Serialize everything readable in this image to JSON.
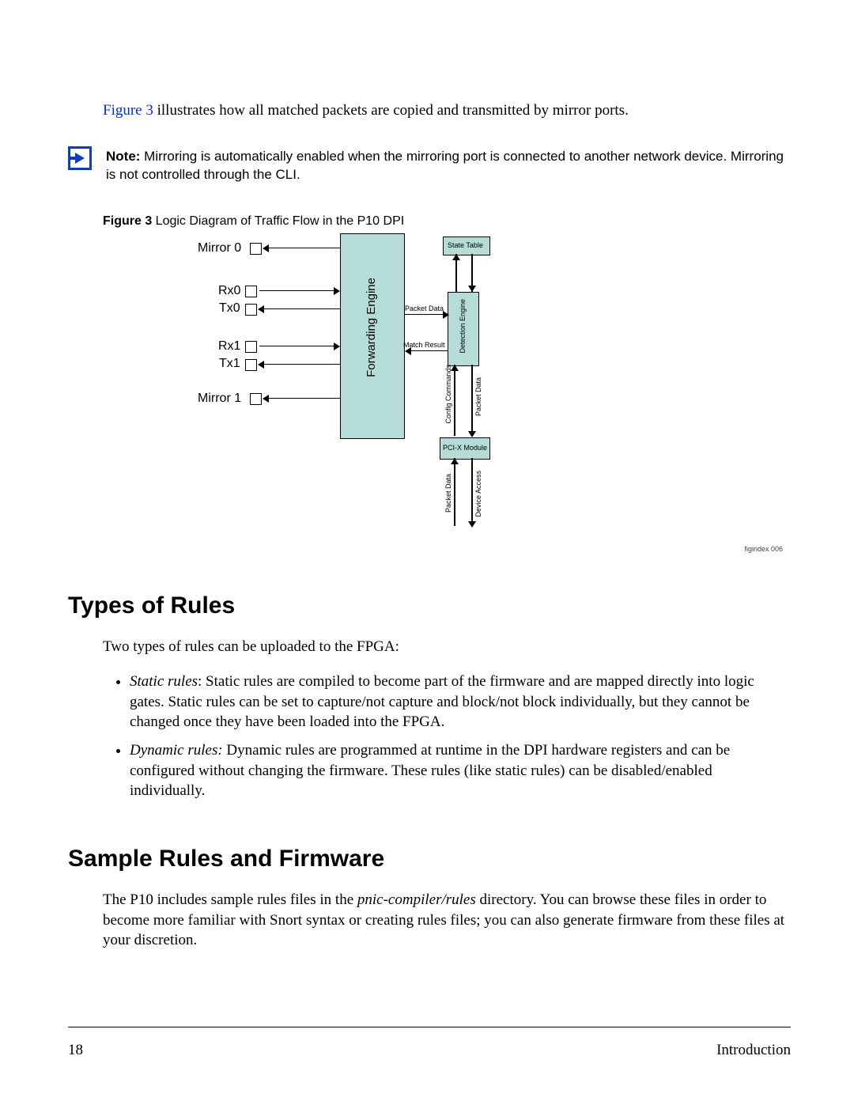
{
  "intro_figure_link": "Figure 3",
  "intro_rest": " illustrates how all matched packets are copied and transmitted by mirror ports.",
  "note": {
    "label": "Note:",
    "text": " Mirroring is automatically enabled when the mirroring port is connected to another network device. Mirroring is not controlled through the CLI."
  },
  "figure_caption": {
    "number": "Figure 3",
    "title": "   Logic Diagram of Traffic Flow in the P10 DPI"
  },
  "diagram": {
    "mirror0": "Mirror 0",
    "rx0": "Rx0",
    "tx0": "Tx0",
    "rx1": "Rx1",
    "tx1": "Tx1",
    "mirror1": "Mirror 1",
    "forwarding_engine": "Forwarding Engine",
    "state_table": "State Table",
    "detection_engine": "Detection Engine",
    "packet_data": "Packet Data",
    "match_result": "Match Result",
    "config_commands": "Config Commands",
    "packet_data2": "Packet Data",
    "pcix_module": "PCI-X Module",
    "packet_data3": "Packet Data",
    "device_access": "Device Access",
    "figindex": "figindex 006"
  },
  "heading_types": "Types of Rules",
  "types_intro": "Two types of rules can be uploaded to the FPGA:",
  "static_label": "Static rules",
  "static_text": ": Static rules are compiled to become part of the firmware and are mapped directly into logic gates. Static rules can be set to capture/not capture and block/not block individually, but they cannot be changed once they have been loaded into the FPGA.",
  "dynamic_label": "Dynamic rules:",
  "dynamic_text": " Dynamic rules are programmed at runtime in the DPI hardware registers and can be configured without changing the firmware. These rules (like static rules) can be disabled/enabled individually.",
  "heading_sample": "Sample Rules and Firmware",
  "sample_text_1": "The P10 includes sample rules files in the ",
  "sample_dir": "pnic-compiler/rules",
  "sample_text_2": " directory. You can browse these files in order to become more familiar with Snort syntax or creating rules files; you can also generate firmware from these files at your discretion.",
  "footer": {
    "page": "18",
    "section": "Introduction"
  }
}
